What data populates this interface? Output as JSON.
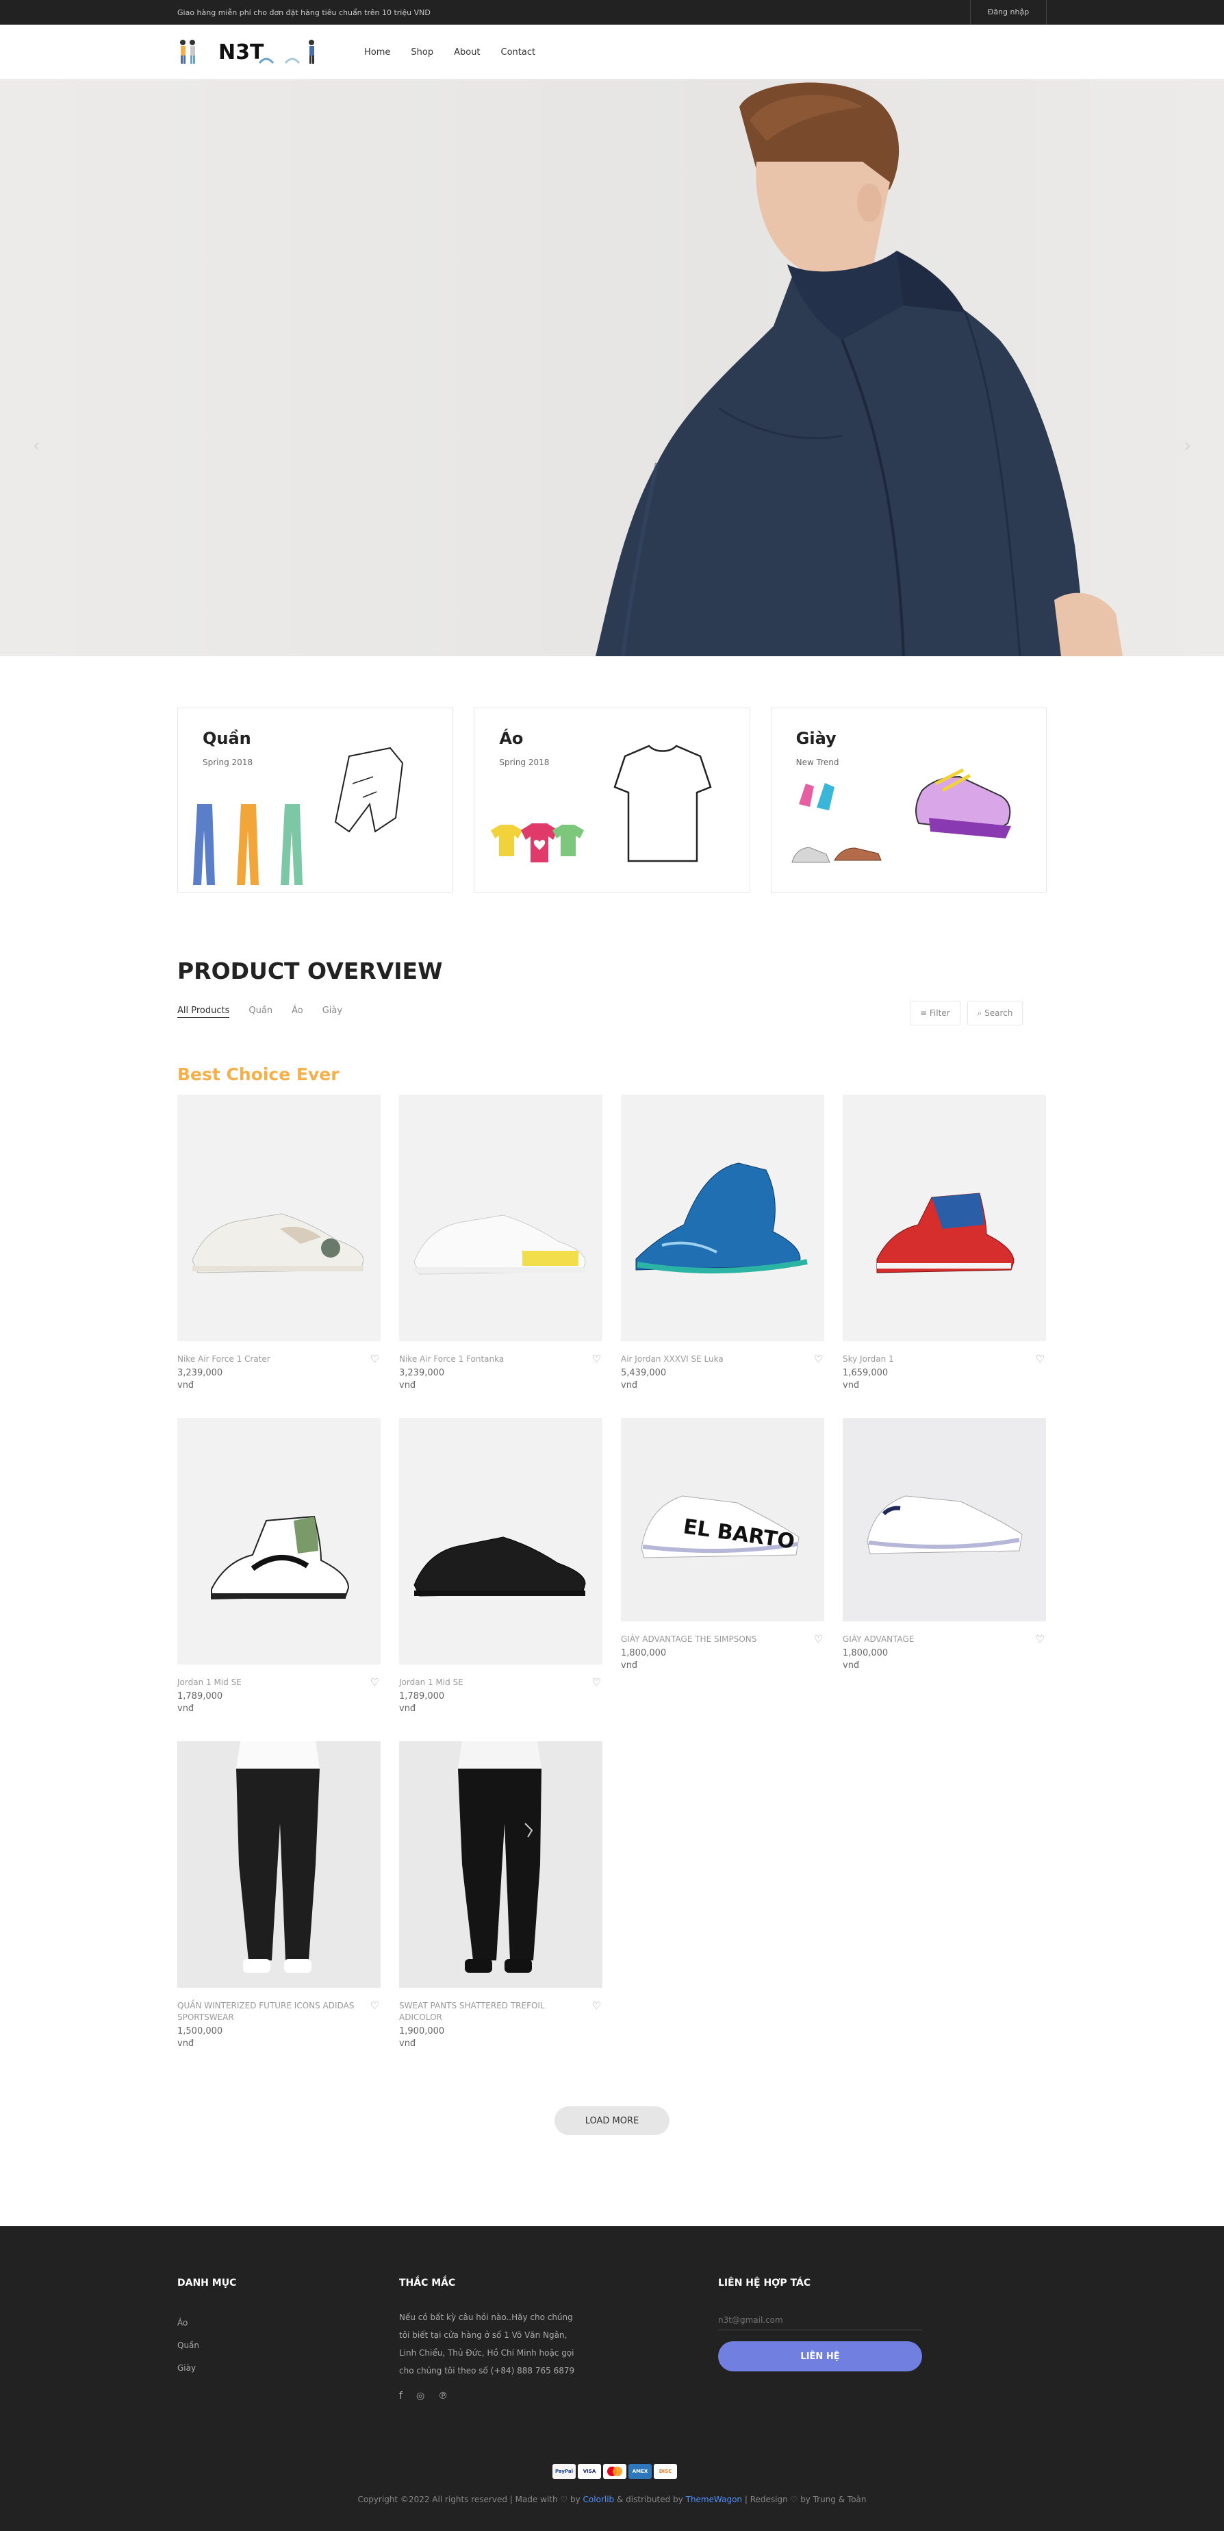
{
  "topbar": {
    "message": "Giao hàng miễn phí cho đơn đặt hàng tiêu chuẩn trên 10 triệu VND",
    "login": "Đăng nhập"
  },
  "header": {
    "logo_text": "N3T",
    "nav": [
      "Home",
      "Shop",
      "About",
      "Contact"
    ]
  },
  "banners": [
    {
      "title": "Quần",
      "subtitle": "Spring 2018"
    },
    {
      "title": "Áo",
      "subtitle": "Spring 2018"
    },
    {
      "title": "Giày",
      "subtitle": "New Trend"
    }
  ],
  "overview": {
    "title": "PRODUCT OVERVIEW",
    "filters": [
      "All Products",
      "Quần",
      "Áo",
      "Giày"
    ],
    "filter_button": "Filter",
    "search_button": "Search",
    "section_title": "Best Choice Ever"
  },
  "products": [
    {
      "name": "Nike Air Force 1 Crater",
      "price": "3,239,000",
      "currency": "vnđ"
    },
    {
      "name": "Nike Air Force 1 Fontanka",
      "price": "3,239,000",
      "currency": "vnđ"
    },
    {
      "name": "Air Jordan XXXVI SE Luka",
      "price": "5,439,000",
      "currency": "vnđ"
    },
    {
      "name": "Sky Jordan 1",
      "price": "1,659,000",
      "currency": "vnđ"
    },
    {
      "name": "Jordan 1 Mid SE",
      "price": "1,789,000",
      "currency": "vnđ"
    },
    {
      "name": "Jordan 1 Mid SE",
      "price": "1,789,000",
      "currency": "vnđ"
    },
    {
      "name": "GIÀY ADVANTAGE THE SIMPSONS",
      "price": "1,800,000",
      "currency": "vnđ"
    },
    {
      "name": "GIÀY ADVANTAGE",
      "price": "1,800,000",
      "currency": "vnđ"
    },
    {
      "name": "QUẦN WINTERIZED FUTURE ICONS ADIDAS SPORTSWEAR",
      "price": "1,500,000",
      "currency": "vnđ"
    },
    {
      "name": "SWEAT PANTS SHATTERED TREFOIL ADICOLOR",
      "price": "1,900,000",
      "currency": "vnđ"
    }
  ],
  "load_more": "LOAD MORE",
  "footer": {
    "categories_title": "DANH MỤC",
    "categories": [
      "Áo",
      "Quần",
      "Giày"
    ],
    "faq_title": "THẮC MẮC",
    "faq_lines": [
      "Nếu có bất kỳ câu hỏi nào..Hãy cho chúng",
      "tôi biết tại cửa hàng ở số 1 Võ Văn Ngân,",
      "Linh Chiểu, Thủ Đức, Hồ Chí Minh hoặc gọi",
      "cho chúng tôi theo số (+84) 888 765 6879"
    ],
    "contact_title": "LIÊN HỆ HỢP TÁC",
    "email_placeholder": "n3t@gmail.com",
    "contact_button": "LIÊN HỆ",
    "copyright_pre": "Copyright ©2022 All rights reserved | Made with ♡ by ",
    "colorlib": "Colorlib",
    "copyright_mid": " & distributed by ",
    "themewagon": "ThemeWagon",
    "copyright_post": " | Redesign ♡ by Trung & Toàn"
  },
  "colors": {
    "accent": "#717fe0",
    "best_choice": "#f4b04a",
    "dark": "#222222"
  }
}
